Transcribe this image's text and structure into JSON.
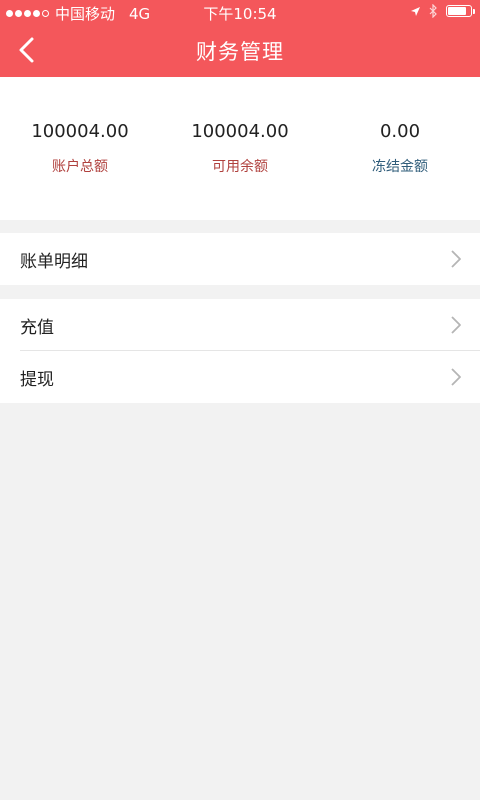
{
  "status_bar": {
    "carrier": "中国移动",
    "network": "4G",
    "time": "下午10:54",
    "signal_bars_filled": 4,
    "signal_bars_total": 5,
    "battery_level": 0.9,
    "icons": [
      "location-arrow-icon",
      "bluetooth-icon",
      "battery-icon"
    ]
  },
  "nav": {
    "title": "财务管理",
    "back_icon": "chevron-left-icon"
  },
  "balances": [
    {
      "value": "100004.00",
      "label": "账户总额",
      "color": "#b0413e"
    },
    {
      "value": "100004.00",
      "label": "可用余额",
      "color": "#b0413e"
    },
    {
      "value": "0.00",
      "label": "冻结金额",
      "color": "#2f5c7a"
    }
  ],
  "menu": {
    "bill_detail": "账单明细",
    "recharge": "充值",
    "withdraw": "提现",
    "chevron_icon": "chevron-right-icon"
  },
  "colors": {
    "header": "#f4575b",
    "page_bg": "#f2f2f2"
  }
}
